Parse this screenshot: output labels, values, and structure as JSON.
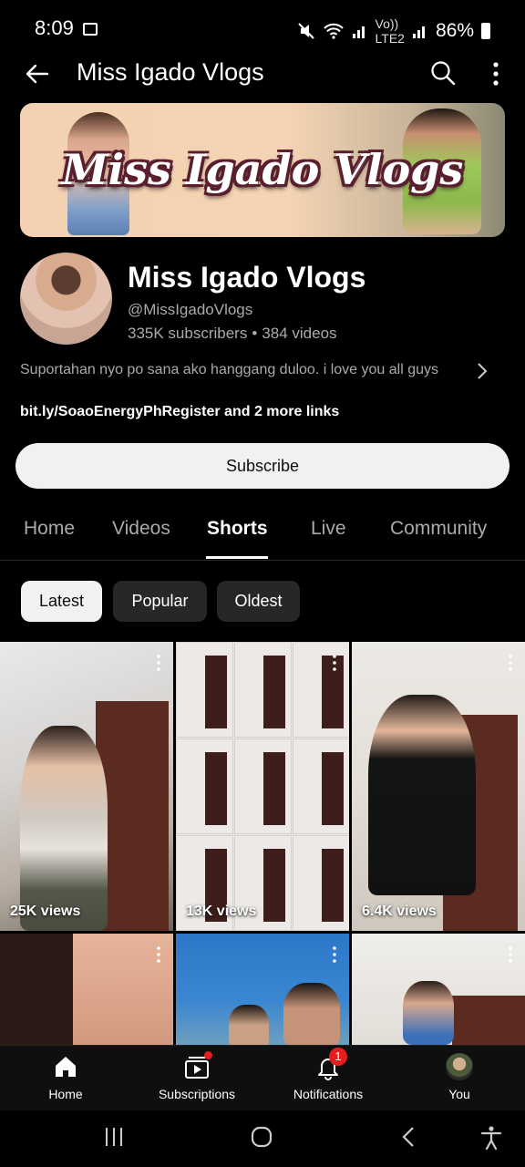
{
  "status_bar": {
    "time": "8:09",
    "network": "LTE2",
    "volte": "Vo))",
    "battery": "86%"
  },
  "header": {
    "title": "Miss Igado Vlogs"
  },
  "banner": {
    "brand_text": "Miss Igado Vlogs"
  },
  "channel": {
    "name": "Miss Igado Vlogs",
    "handle": "@MissIgadoVlogs",
    "subscribers": "335K subscribers",
    "separator": "•",
    "videos": "384 videos",
    "description": "Suportahan nyo po sana ako hanggang duloo. i love you all guys",
    "links": "bit.ly/SoaoEnergyPhRegister and 2 more links",
    "subscribe_label": "Subscribe"
  },
  "tabs": [
    {
      "label": "Home"
    },
    {
      "label": "Videos"
    },
    {
      "label": "Shorts",
      "active": true
    },
    {
      "label": "Live"
    },
    {
      "label": "Community"
    }
  ],
  "chips": [
    {
      "label": "Latest",
      "selected": true
    },
    {
      "label": "Popular"
    },
    {
      "label": "Oldest"
    }
  ],
  "shorts": [
    {
      "views": "25K views"
    },
    {
      "views": "13K views"
    },
    {
      "views": "6.4K views"
    },
    {
      "views": ""
    },
    {
      "views": ""
    },
    {
      "views": ""
    }
  ],
  "bottom_nav": [
    {
      "label": "Home",
      "icon": "home-icon"
    },
    {
      "label": "Subscriptions",
      "icon": "subscriptions-icon"
    },
    {
      "label": "Notifications",
      "icon": "bell-icon",
      "badge": "1"
    },
    {
      "label": "You",
      "icon": "avatar"
    }
  ],
  "colors": {
    "background": "#000000",
    "secondary_text": "#aaaaaa",
    "badge_red": "#e41e1e",
    "chip_bg": "#272727",
    "subscribe_bg": "#f1f1f1"
  }
}
